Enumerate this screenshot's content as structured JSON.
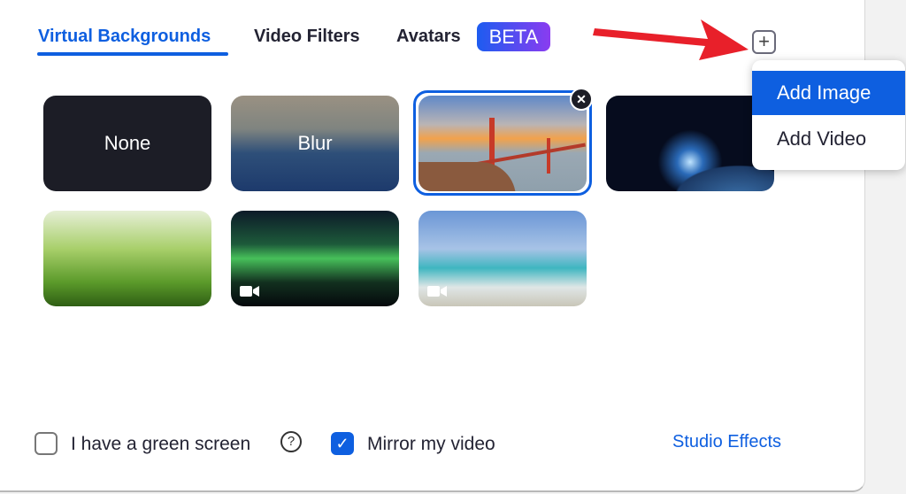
{
  "tabs": [
    {
      "label": "Virtual Backgrounds",
      "active": true
    },
    {
      "label": "Video Filters"
    },
    {
      "label": "Avatars",
      "badge": "BETA"
    }
  ],
  "backgrounds": [
    {
      "label": "None"
    },
    {
      "label": "Blur"
    },
    {
      "name": "Golden Gate Bridge",
      "selected": true
    },
    {
      "name": "Earth from space"
    },
    {
      "name": "Grass"
    },
    {
      "name": "Aurora",
      "type": "video"
    },
    {
      "name": "Beach palm",
      "type": "video"
    }
  ],
  "add_menu": {
    "items": [
      "Add Image",
      "Add Video"
    ],
    "highlighted": "Add Image"
  },
  "options": {
    "green_screen": {
      "label": "I have a green screen",
      "checked": false
    },
    "mirror": {
      "label": "Mirror my video",
      "checked": true
    }
  },
  "studio_effects": "Studio Effects",
  "icons": {
    "add": "plus-icon",
    "remove": "close-icon",
    "video": "video-camera-icon",
    "help": "question-icon"
  },
  "colors": {
    "accent": "#0e5fe0",
    "annotation_arrow": "#e8202a"
  }
}
